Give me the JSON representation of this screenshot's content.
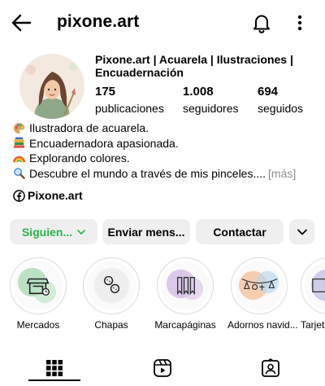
{
  "header": {
    "username": "pixone.art",
    "icons": [
      "back-arrow-icon",
      "bell-icon",
      "more-vertical-icon"
    ]
  },
  "profile": {
    "display_name": "Pixone.art | Acuarela | Ilustraciones | Encuadernación",
    "stats": [
      {
        "value": "175",
        "label": "publicaciones"
      },
      {
        "value": "1.008",
        "label": "seguidores"
      },
      {
        "value": "694",
        "label": "seguidos"
      }
    ],
    "bio": [
      {
        "icon": "palette-icon",
        "text": "Ilustradora de acuarela."
      },
      {
        "icon": "books-icon",
        "text": "Encuadernadora apasionada."
      },
      {
        "icon": "rainbow-icon",
        "text": "Explorando colores."
      },
      {
        "icon": "magnifier-icon",
        "text": "Descubre el mundo a través de mis pinceles...."
      }
    ],
    "more_label": "[más]",
    "link_label": "Pixone.art"
  },
  "actions": {
    "follow_label": "Siguien...",
    "message_label": "Enviar mens...",
    "contact_label": "Contactar",
    "follow_color": "#2bb24c"
  },
  "highlights": [
    {
      "label": "Mercados",
      "icon": "market-stall-icon",
      "color": "#8fd0a0"
    },
    {
      "label": "Chapas",
      "icon": "buttons-icon",
      "color": "#d8d8d8"
    },
    {
      "label": "Marcapáginas",
      "icon": "bookmarks-icon",
      "color": "#c8a8e0"
    },
    {
      "label": "Adornos navid...",
      "icon": "garland-icon",
      "color": "#f0b080"
    },
    {
      "label": "Tarjeta",
      "icon": "cards-icon",
      "color": "#b0b0e0"
    }
  ],
  "tabs": [
    "grid-icon",
    "reels-icon",
    "tagged-icon"
  ]
}
